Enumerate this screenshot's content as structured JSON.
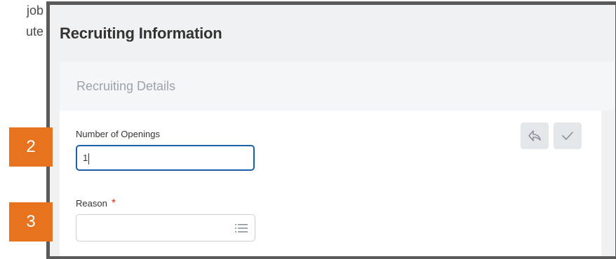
{
  "background_text": {
    "line1": "job",
    "line2": "ute"
  },
  "page": {
    "title": "Recruiting Information"
  },
  "section": {
    "header_label": "Recruiting Details",
    "fields": {
      "openings": {
        "label": "Number of Openings",
        "value": "1"
      },
      "reason": {
        "label": "Reason",
        "required_marker": "*",
        "value": ""
      }
    },
    "actions": {
      "undo_icon": "undo-icon",
      "confirm_icon": "check-icon"
    }
  },
  "badges": {
    "step2": "2",
    "step3": "3"
  },
  "colors": {
    "frame": "#5a5a5a",
    "accent_blue": "#1a5fa8",
    "required_red": "#de2e21",
    "badge_orange": "#e8731f",
    "section_header_text": "#9aa3ab"
  }
}
